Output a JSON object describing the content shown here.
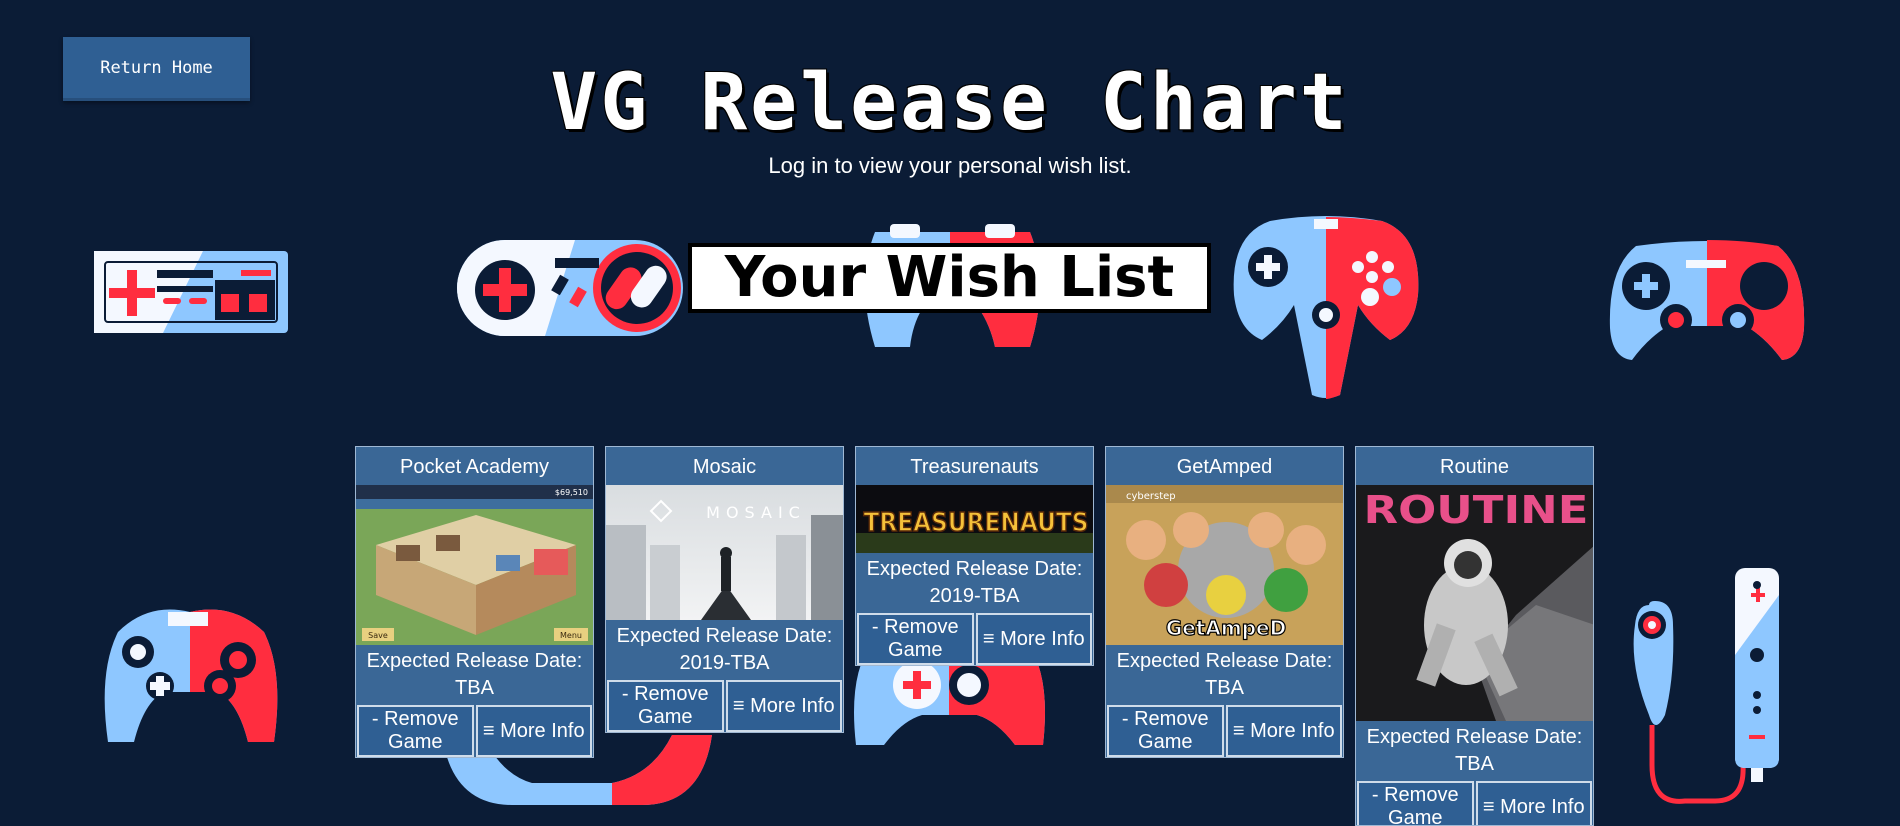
{
  "nav": {
    "home_label": "Return Home"
  },
  "header": {
    "title": "VG Release Chart",
    "subtitle": "Log in to view your personal wish list."
  },
  "wishlist": {
    "heading": "Your Wish List",
    "games": [
      {
        "title": "Pocket Academy",
        "date_label": "Expected Release Date:",
        "date": "TBA",
        "remove_label": "- Remove Game",
        "info_label": "≡ More Info"
      },
      {
        "title": "Mosaic",
        "date_label": "Expected Release Date:",
        "date": "2019-TBA",
        "remove_label": "- Remove Game",
        "info_label": "≡ More Info",
        "image_text": "MOSAIC"
      },
      {
        "title": "Treasurenauts",
        "date_label": "Expected Release Date:",
        "date": "2019-TBA",
        "remove_label": "- Remove Game",
        "info_label": "≡ More Info",
        "image_text": "TREASURENAUTS"
      },
      {
        "title": "GetAmped",
        "date_label": "Expected Release Date:",
        "date": "TBA",
        "remove_label": "- Remove Game",
        "info_label": "≡ More Info",
        "image_text": "GetAmpeD",
        "image_brand": "cyberstep"
      },
      {
        "title": "Routine",
        "date_label": "Expected Release Date:",
        "date": "TBA",
        "remove_label": "- Remove Game",
        "info_label": "≡ More Info",
        "image_text": "ROUTINE"
      }
    ]
  },
  "pocket_hud": {
    "money": "$69,510",
    "save": "Save",
    "menu": "Menu"
  },
  "colors": {
    "background": "#0b1c36",
    "card": "#3a6796",
    "accent_red": "#ff2d3f",
    "accent_blue": "#8ec7ff"
  }
}
